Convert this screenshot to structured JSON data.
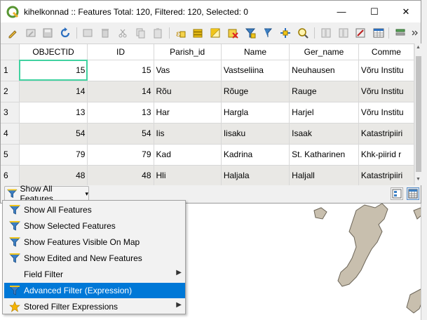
{
  "window": {
    "title": "kihelkonnad :: Features Total: 120, Filtered: 120, Selected: 0",
    "minimize_glyph": "—",
    "maximize_glyph": "☐",
    "close_glyph": "✕"
  },
  "toolbar": {
    "icons": [
      "edit-pencil-icon",
      "multi-edit-icon",
      "save-icon",
      "reload-icon",
      "add-feature-icon",
      "delete-icon",
      "cut-icon",
      "copy-icon",
      "paste-icon",
      "select-by-expression-icon",
      "select-all-icon",
      "invert-selection-icon",
      "deselect-all-icon",
      "filter-selection-icon",
      "move-selection-top-icon",
      "pan-to-selection-icon",
      "zoom-to-selection-icon",
      "new-field-icon",
      "delete-field-icon",
      "field-calculator-icon",
      "conditional-formatting-icon",
      "actions-icon",
      "more-icon"
    ]
  },
  "table": {
    "columns": [
      "OBJECTID",
      "ID",
      "Parish_id",
      "Name",
      "Ger_name",
      "Comme"
    ],
    "rows": [
      {
        "row": "1",
        "cells": [
          "15",
          "15",
          "Vas",
          "Vastseliina",
          "Neuhausen",
          "Võru Institu"
        ]
      },
      {
        "row": "2",
        "cells": [
          "14",
          "14",
          "Rõu",
          "Rõuge",
          "Rauge",
          "Võru Institu"
        ]
      },
      {
        "row": "3",
        "cells": [
          "13",
          "13",
          "Har",
          "Hargla",
          "Harjel",
          "Võru Institu"
        ]
      },
      {
        "row": "4",
        "cells": [
          "54",
          "54",
          "Iis",
          "Iisaku",
          "Isaak",
          "Katastripiiri"
        ]
      },
      {
        "row": "5",
        "cells": [
          "79",
          "79",
          "Kad",
          "Kadrina",
          "St. Katharinen",
          "Khk-piirid r"
        ]
      },
      {
        "row": "6",
        "cells": [
          "48",
          "48",
          "Hli",
          "Haljala",
          "Haljall",
          "Katastripiiri"
        ]
      }
    ]
  },
  "bottombar": {
    "filter_button_label": "Show All Features",
    "dropdown_arrow": "▾"
  },
  "menu": {
    "items": [
      {
        "label": "Show All Features",
        "icon": "funnel-icon",
        "submenu": false,
        "active": false
      },
      {
        "label": "Show Selected Features",
        "icon": "funnel-icon",
        "submenu": false,
        "active": false
      },
      {
        "label": "Show Features Visible On Map",
        "icon": "funnel-icon",
        "submenu": false,
        "active": false
      },
      {
        "label": "Show Edited and New Features",
        "icon": "funnel-icon",
        "submenu": false,
        "active": false
      },
      {
        "label": "Field Filter",
        "icon": "",
        "submenu": true,
        "active": false
      },
      {
        "label": "Advanced Filter (Expression)",
        "icon": "funnel-icon",
        "submenu": false,
        "active": true
      },
      {
        "label": "Stored Filter Expressions",
        "icon": "star-icon",
        "submenu": true,
        "active": false
      }
    ],
    "submenu_arrow": "▶"
  },
  "colors": {
    "selection_accent": "#0078d7",
    "cell_focus": "#41d2a0",
    "map_island": "#c8bfae",
    "alt_row": "#e9e8e5"
  }
}
